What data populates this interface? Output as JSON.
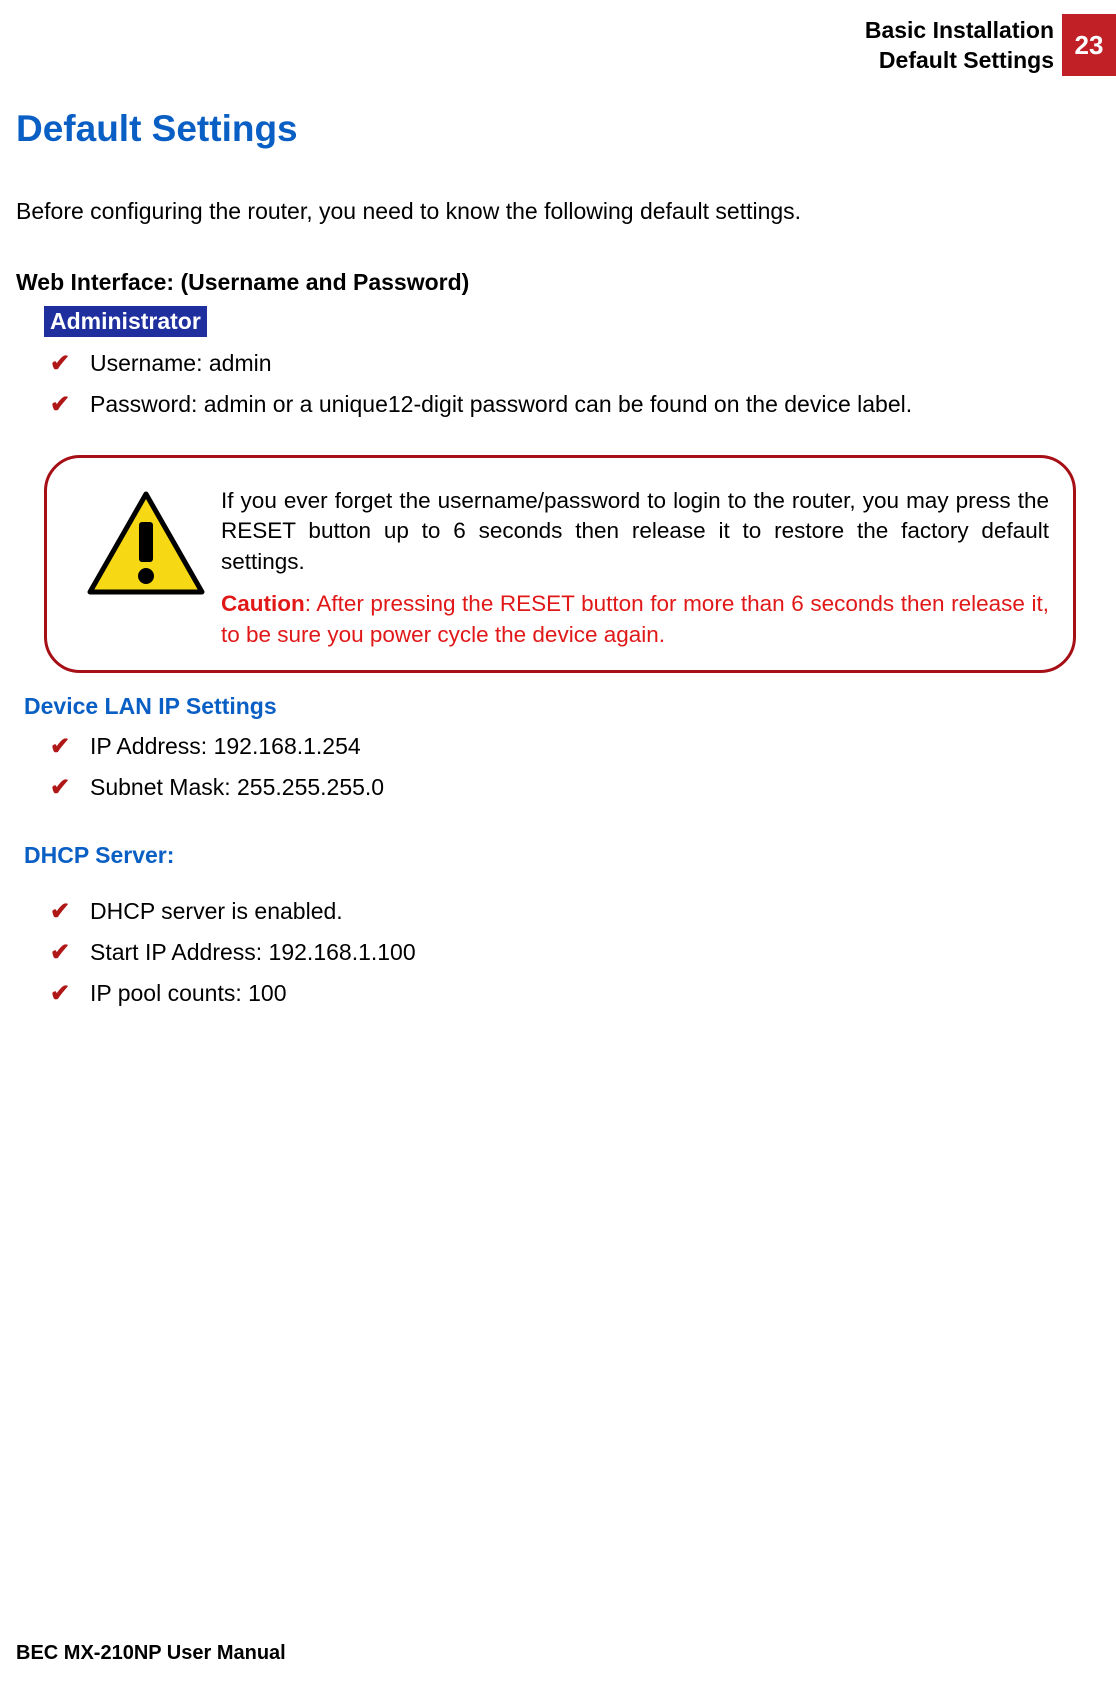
{
  "header": {
    "line1": "Basic Installation",
    "line2": "Default Settings",
    "page_number": "23"
  },
  "section_title": "Default Settings",
  "intro": "Before configuring the router, you need to know the following default settings.",
  "web_interface": {
    "heading": "Web Interface: (Username and Password)",
    "admin_label": "Administrator",
    "items": [
      "Username: admin",
      "Password: admin or a unique12-digit password can be found on the device label."
    ]
  },
  "callout": {
    "p1": "If you ever forget the username/password to login to the router, you may press the RESET button up to 6 seconds then release it to restore the factory default settings.",
    "caution_label": "Caution",
    "caution_text": ": After pressing the RESET button for more than 6 seconds then release it, to be sure you power cycle the device again."
  },
  "lan": {
    "heading": "Device LAN IP Settings",
    "items": [
      "IP Address: 192.168.1.254",
      "Subnet Mask: 255.255.255.0"
    ]
  },
  "dhcp": {
    "heading": "DHCP Server:",
    "items": [
      "DHCP server is enabled.",
      "Start IP Address: 192.168.1.100",
      "IP pool counts: 100"
    ]
  },
  "footer": "BEC MX-210NP User Manual"
}
